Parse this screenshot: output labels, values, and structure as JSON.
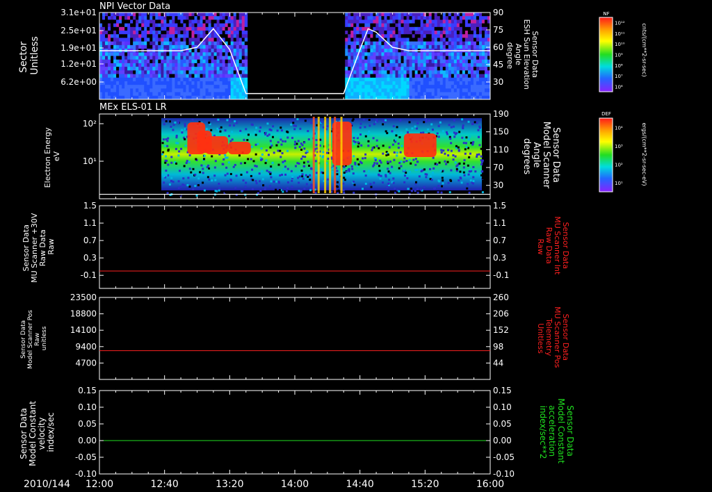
{
  "colors": {
    "background": "#000000",
    "axes": "#ffffff",
    "red_trace": "#ff2020",
    "green_trace": "#20e020",
    "white_trace": "#ffffff"
  },
  "time_axis": {
    "date_label": "2010/144",
    "tick_labels": [
      "12:00",
      "12:40",
      "13:20",
      "14:00",
      "14:40",
      "15:20",
      "16:00"
    ],
    "range_minutes": [
      0,
      240
    ]
  },
  "chart_data": [
    {
      "type": "heatmap",
      "title": "NPI Vector Data",
      "ylabel_lines": [
        "Sector",
        "Unitless"
      ],
      "yticks": [
        "3.1e+01",
        "2.5e+01",
        "1.9e+01",
        "1.2e+01",
        "6.2e+00"
      ],
      "right_ylabel_lines": [
        "Sensor Data",
        "ESH Sun Elevation",
        "Angle",
        "degree"
      ],
      "right_yticks": [
        "90",
        "75",
        "60",
        "45",
        "30"
      ],
      "right_ylim": [
        15,
        90
      ],
      "data_gap_minutes": [
        90,
        150
      ],
      "overlay": {
        "x": [
          0,
          50,
          60,
          70,
          80,
          90,
          100,
          150,
          160,
          165,
          170,
          180,
          190,
          240
        ],
        "y": [
          57,
          57,
          60,
          76,
          58,
          20,
          20,
          20,
          58,
          76,
          73,
          60,
          57,
          57
        ]
      },
      "colorbar": {
        "title": "NF",
        "units": "cnts/(cm**2-sr-sec)",
        "tick_labels": [
          "10¹²",
          "10¹¹",
          "10¹⁰",
          "10⁹",
          "10⁸",
          "10⁷",
          "10⁶"
        ]
      }
    },
    {
      "type": "heatmap",
      "title": "MEx ELS-01 LR",
      "ylabel_lines": [
        "Electron Energy",
        "eV"
      ],
      "yticks": [
        "10²",
        "10¹"
      ],
      "right_ylabel_lines": [
        "Sensor Data",
        "Model Scanner",
        "Angle",
        "degrees"
      ],
      "right_yticks": [
        "190",
        "150",
        "110",
        "70",
        "30"
      ],
      "right_ylim": [
        0,
        190
      ],
      "data_start_minute": 38,
      "overlay": {
        "x": [
          0,
          240
        ],
        "y": [
          10,
          10
        ]
      },
      "colorbar": {
        "title": "DEF",
        "units": "ergs/(cm**2-sr-sec-eV)",
        "tick_labels": [
          "10⁴",
          "10³",
          "10²",
          "10¹"
        ]
      }
    },
    {
      "type": "line",
      "ylabel_lines": [
        "Sensor Data",
        "MU Scanner +30V",
        "Raw Data",
        "Raw"
      ],
      "yticks": [
        "1.5",
        "1.1",
        "0.7",
        "0.3",
        "-0.1"
      ],
      "ylim": [
        -0.4,
        1.5
      ],
      "right_ylabel_lines": [
        "Sensor Data",
        "MU Scanner Int",
        "Raw Data",
        "Raw"
      ],
      "right_yticks": [
        "1.5",
        "1.1",
        "0.7",
        "0.3",
        "-0.1"
      ],
      "series": [
        {
          "x": [
            0,
            240
          ],
          "y": [
            0,
            0
          ],
          "color": "#ff2020"
        }
      ]
    },
    {
      "type": "line",
      "ylabel_lines": [
        "Sensor Data",
        "Model Scanner Pos",
        "Raw",
        "unitless"
      ],
      "yticks": [
        "23500",
        "18800",
        "14100",
        "9400",
        "4700"
      ],
      "ylim": [
        0,
        23500
      ],
      "right_ylabel_lines": [
        "Sensor Data",
        "MU Scanner Pos",
        "Telemetry",
        "Unitless"
      ],
      "right_yticks": [
        "260",
        "206",
        "152",
        "98",
        "44"
      ],
      "series": [
        {
          "x": [
            0,
            240
          ],
          "y": [
            8250,
            8250
          ],
          "color": "#ff2020"
        }
      ]
    },
    {
      "type": "line",
      "ylabel_lines": [
        "Sensor Data",
        "Model Constant",
        "velocity",
        "index/sec"
      ],
      "yticks": [
        "0.15",
        "0.10",
        "0.05",
        "0.00",
        "-0.05",
        "-0.10"
      ],
      "ylim": [
        -0.1,
        0.15
      ],
      "right_ylabel_lines": [
        "Sensor Data",
        "Model Constant",
        "acceleration",
        "index/sec**2"
      ],
      "right_yticks": [
        "0.15",
        "0.10",
        "0.05",
        "0.00",
        "-0.05",
        "-0.10"
      ],
      "series": [
        {
          "x": [
            0,
            240
          ],
          "y": [
            0,
            0
          ],
          "color": "#20e020"
        }
      ]
    }
  ]
}
